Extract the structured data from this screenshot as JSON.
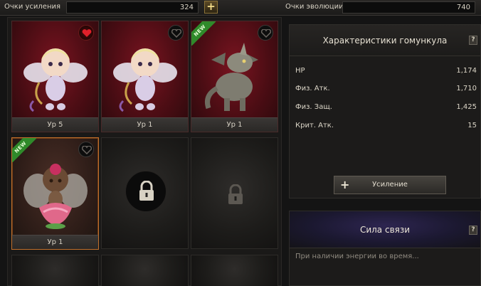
{
  "topbar": {
    "boost_points_label": "Очки усиления",
    "boost_points_value": "324",
    "add_label": "+",
    "evolution_points_label": "Очки эволюции",
    "evolution_points_value": "740"
  },
  "slots": [
    {
      "level": "Ур 5",
      "favorite": true,
      "is_new": false,
      "creature": "cupid-fairy"
    },
    {
      "level": "Ур 1",
      "favorite": false,
      "is_new": false,
      "creature": "cupid-fairy"
    },
    {
      "level": "Ур 1",
      "favorite": false,
      "is_new": true,
      "creature": "gray-dragon"
    },
    {
      "level": "Ур 1",
      "favorite": false,
      "is_new": true,
      "creature": "flower-fairy"
    }
  ],
  "new_badge": "NEW",
  "stats_panel": {
    "title": "Характеристики гомункула",
    "help": "?",
    "rows": [
      {
        "label": "HP",
        "value": "1,174"
      },
      {
        "label": "Физ. Атк.",
        "value": "1,710"
      },
      {
        "label": "Физ. Защ.",
        "value": "1,425"
      },
      {
        "label": "Крит. Атк.",
        "value": "15"
      }
    ],
    "upgrade_label": "Усиление",
    "upgrade_icon": "+"
  },
  "bond_panel": {
    "title": "Сила связи",
    "help": "?",
    "text": "При наличии энергии во время..."
  },
  "colors": {
    "card_red": "#4c0d14",
    "selected_border": "#c2702c",
    "new_green": "#2f8a2a",
    "heart_red": "#e0202a"
  }
}
